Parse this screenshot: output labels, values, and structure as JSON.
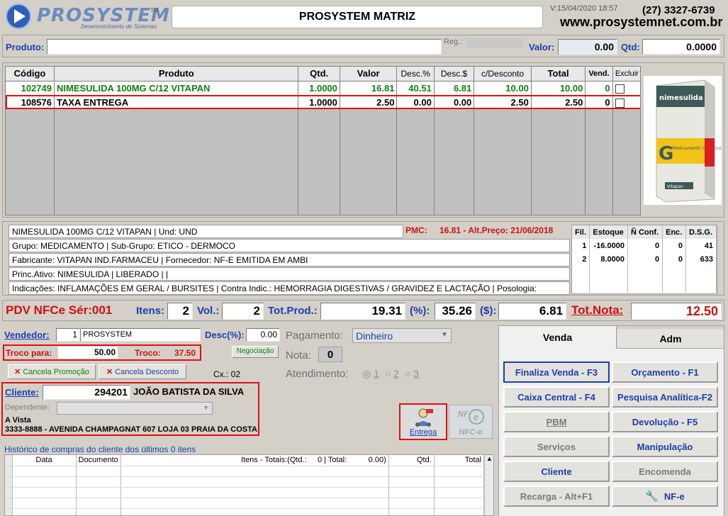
{
  "header": {
    "logo_text": "PROSYSTEM",
    "logo_tm": "TM",
    "logo_tagline": "Desenvolvimento de Sistemas",
    "store_name": "PROSYSTEM MATRIZ",
    "version": "V:15/04/2020 18:57",
    "phone": "(27) 3327-6739",
    "website": "www.prosystemnet.com.br"
  },
  "product_bar": {
    "produto_label": "Produto:",
    "produto_value": "",
    "reg_label": "Reg.:",
    "valor_label": "Valor:",
    "valor_value": "0.00",
    "qtd_label": "Qtd:",
    "qtd_value": "0.0000"
  },
  "items_table": {
    "headers": [
      "Código",
      "Produto",
      "Qtd.",
      "Valor",
      "Desc.%",
      "Desc.$",
      "c/Desconto",
      "Total",
      "Vend.",
      "Excluir"
    ],
    "rows": [
      {
        "codigo": "102749",
        "produto": "NIMESULIDA 100MG C/12 VITAPAN",
        "qtd": "1.0000",
        "valor": "16.81",
        "desc_pct": "40.51",
        "desc_val": "6.81",
        "c_desc": "10.00",
        "total": "10.00",
        "vend": "0"
      },
      {
        "codigo": "108576",
        "produto": "TAXA ENTREGA",
        "qtd": "1.0000",
        "valor": "2.50",
        "desc_pct": "0.00",
        "desc_val": "0.00",
        "c_desc": "2.50",
        "total": "2.50",
        "vend": "0"
      }
    ]
  },
  "product_image": {
    "brand": "nimesulida",
    "generic_text": "Medicamento Genérico",
    "maker": "Vitapan",
    "colors": {
      "box": "#e8e8e0",
      "band": "#3d5a5a",
      "yellow": "#f2c318",
      "red": "#d82020"
    }
  },
  "product_info": {
    "line1": "NIMESULIDA 100MG C/12 VITAPAN | Und: UND",
    "pmc_label": "PMC:",
    "pmc_value": "16.81 - Alt.Preço: 21/06/2018",
    "line2": "Grupo: MEDICAMENTO | Sub-Grupo: ETICO - DERMOCO",
    "line3": "Fabricante: VITAPAN IND.FARMACEU |  Fornecedor: NF-E EMITIDA EM AMBI",
    "line4": "Princ.Ativo: NIMESULIDA | LIBERADO |  |",
    "line5": "Indicações: INFLAMAÇÕES EM GERAL  /  BURSITES | Contra Indic.: HEMORRAGIA DIGESTIVAS / GRAVIDEZ E LACTAÇÃO | Posologia:"
  },
  "stock_table": {
    "headers": [
      "Fil.",
      "Estoque",
      "Ñ Conf.",
      "Enc.",
      "D.S.G."
    ],
    "rows": [
      [
        "1",
        "-16.0000",
        "0",
        "0",
        "41"
      ],
      [
        "2",
        "8.0000",
        "0",
        "0",
        "633"
      ]
    ]
  },
  "totals": {
    "pdv_label": "PDV NFCe Sér:001",
    "itens_label": "Itens:",
    "itens_value": "2",
    "vol_label": "Vol.:",
    "vol_value": "2",
    "totprod_label": "Tot.Prod.:",
    "totprod_value": "19.31",
    "pct_label": "(%):",
    "pct_value": "35.26",
    "dollar_label": "($):",
    "dollar_value": "6.81",
    "totnota_label": "Tot.Nota:",
    "totnota_value": "12.50"
  },
  "sale": {
    "vendedor_label": "Vendedor:",
    "vendedor_code": "1",
    "vendedor_name": "PROSYSTEM",
    "desc_label": "Desc(%):",
    "desc_value": "0.00",
    "troco_para_label": "Troco para:",
    "troco_para_value": "50.00",
    "troco_label": "Troco:",
    "troco_value": "37.50",
    "negociacao_label": "Negociação",
    "cancela_promocao_label": "Cancela Promoção",
    "cancela_desconto_label": "Cancela Desconto",
    "cx_label": "Cx.: 02",
    "pagamento_label": "Pagamento:",
    "pagamento_value": "Dinheiro",
    "nota_label": "Nota:",
    "nota_value": "0",
    "atendimento_label": "Atendimento:",
    "atendimento_options": [
      "1",
      "2",
      "3"
    ]
  },
  "client": {
    "cliente_label": "Cliente:",
    "cliente_code": "294201",
    "cliente_name": "JOÃO BATISTA DA SILVA",
    "dependente_label": "Dependente:",
    "payment_type": "A Vista",
    "address": "3333-8888 - AVENIDA CHAMPAGNAT 607 LOJA 03 PRAIA DA COSTA",
    "entrega_label": "Entrega",
    "nfce_label": "NFC-e"
  },
  "history": {
    "title": "Histórico de compras do cliente dos últimos 0 itens",
    "headers": [
      "Data",
      "Documento",
      "Itens - Totais:(Qtd.:     0 | Total:          0.00)",
      "Qtd.",
      "Total"
    ]
  },
  "side_panel": {
    "tabs": [
      "Venda",
      "Adm"
    ],
    "buttons": [
      {
        "label": "Finaliza Venda - F3",
        "state": "selected"
      },
      {
        "label": "Orçamento - F1",
        "state": "normal"
      },
      {
        "label": "Caixa Central - F4",
        "state": "normal"
      },
      {
        "label": "Pesquisa Analítica-F2",
        "state": "normal"
      },
      {
        "label": "PBM",
        "state": "disabled"
      },
      {
        "label": "Devolução - F5",
        "state": "normal"
      },
      {
        "label": "Serviços",
        "state": "disabled"
      },
      {
        "label": "Manipulação",
        "state": "normal"
      },
      {
        "label": "Cliente",
        "state": "normal"
      },
      {
        "label": "Encomenda",
        "state": "disabled"
      },
      {
        "label": "Recarga - Alt+F1",
        "state": "disabled"
      },
      {
        "label": "NF-e",
        "state": "normal"
      }
    ]
  }
}
